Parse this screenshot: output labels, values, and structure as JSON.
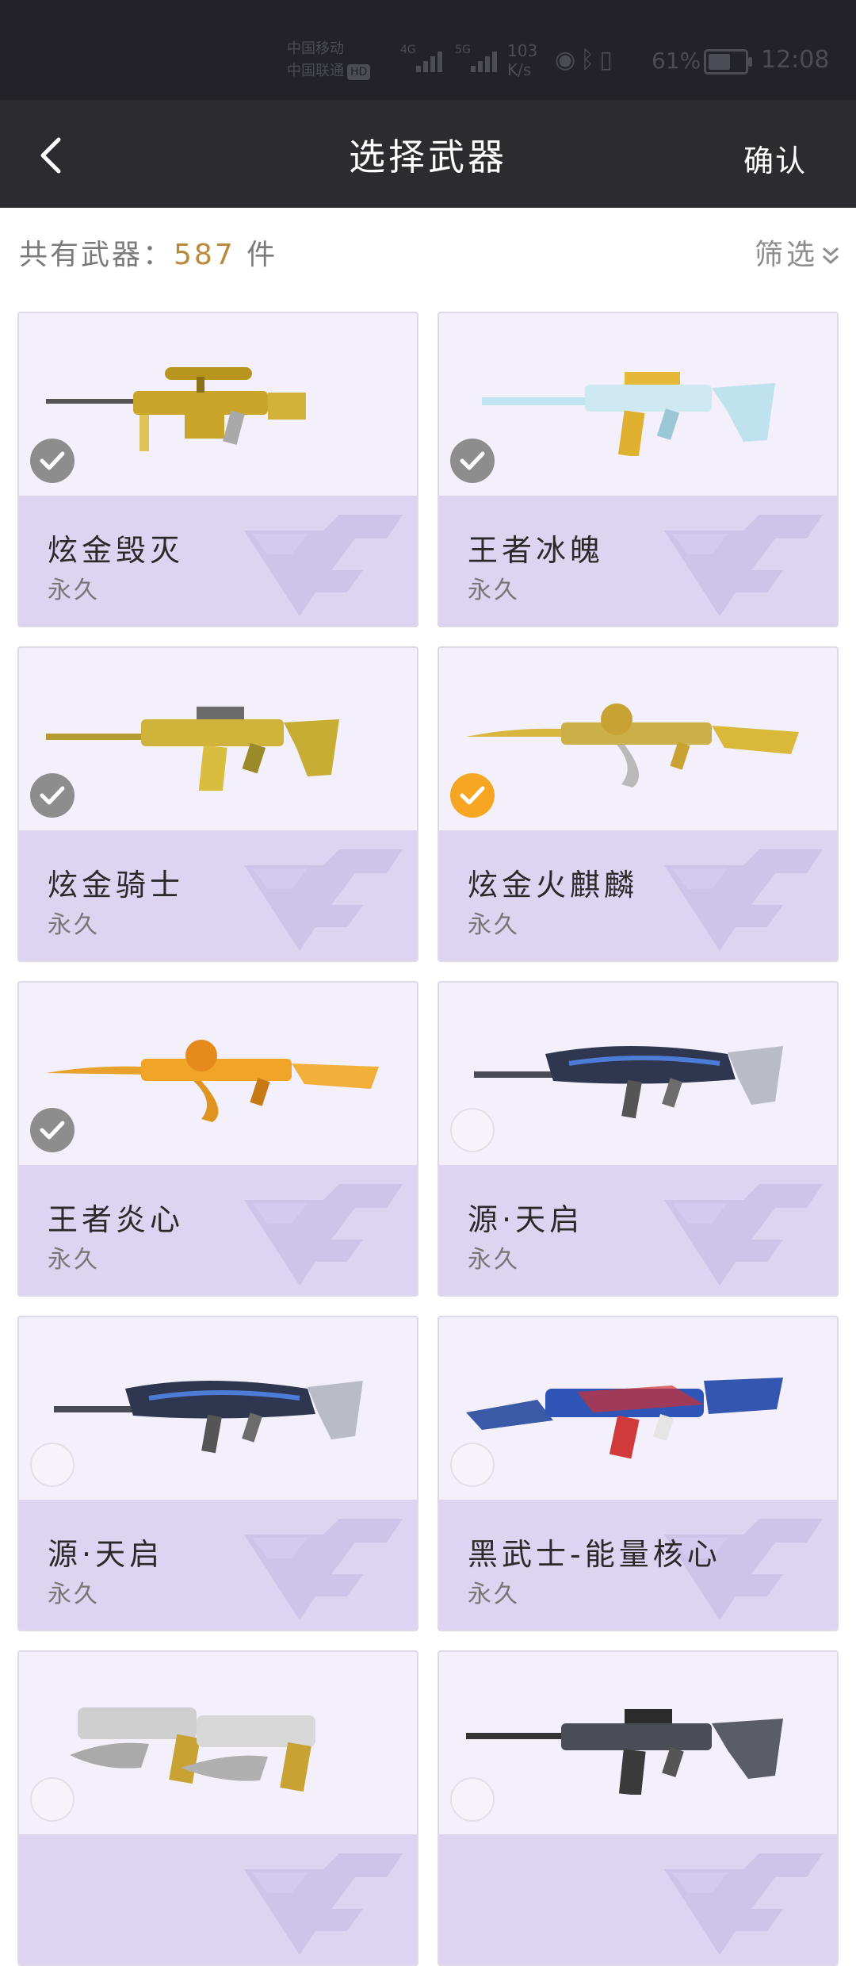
{
  "status_bar": {
    "carrier_1": "中国移动",
    "carrier_2": "中国联通",
    "hd_badge": "HD",
    "signal_1_label": "4G",
    "signal_2_label": "5G",
    "net_speed_value": "103",
    "net_speed_unit": "K/s",
    "battery_percent": "61%",
    "battery_level": 0.61,
    "time": "12:08"
  },
  "header": {
    "back_icon": "chevron-left-icon",
    "title": "选择武器",
    "confirm_label": "确认"
  },
  "summary": {
    "prefix": "共有武器：",
    "count": "587",
    "suffix": " 件",
    "filter_label": "筛选",
    "filter_icon": "double-chevron-down-icon"
  },
  "colors": {
    "accent_orange": "#f6a623",
    "count_gold": "#b98a3b",
    "card_bottom": "#ddd4f1",
    "nav_bg": "#2b2b30"
  },
  "weapons": [
    {
      "name": "炫金毁灭",
      "duration": "永久",
      "state": "checked-gray"
    },
    {
      "name": "王者冰魄",
      "duration": "永久",
      "state": "checked-gray"
    },
    {
      "name": "炫金骑士",
      "duration": "永久",
      "state": "checked-gray"
    },
    {
      "name": "炫金火麒麟",
      "duration": "永久",
      "state": "checked-orange"
    },
    {
      "name": "王者炎心",
      "duration": "永久",
      "state": "checked-gray"
    },
    {
      "name": "源·天启",
      "duration": "永久",
      "state": "unchecked"
    },
    {
      "name": "源·天启",
      "duration": "永久",
      "state": "unchecked"
    },
    {
      "name": "黑武士-能量核心",
      "duration": "永久",
      "state": "unchecked"
    },
    {
      "name": "",
      "duration": "",
      "state": "unchecked"
    },
    {
      "name": "",
      "duration": "",
      "state": "unchecked"
    }
  ]
}
